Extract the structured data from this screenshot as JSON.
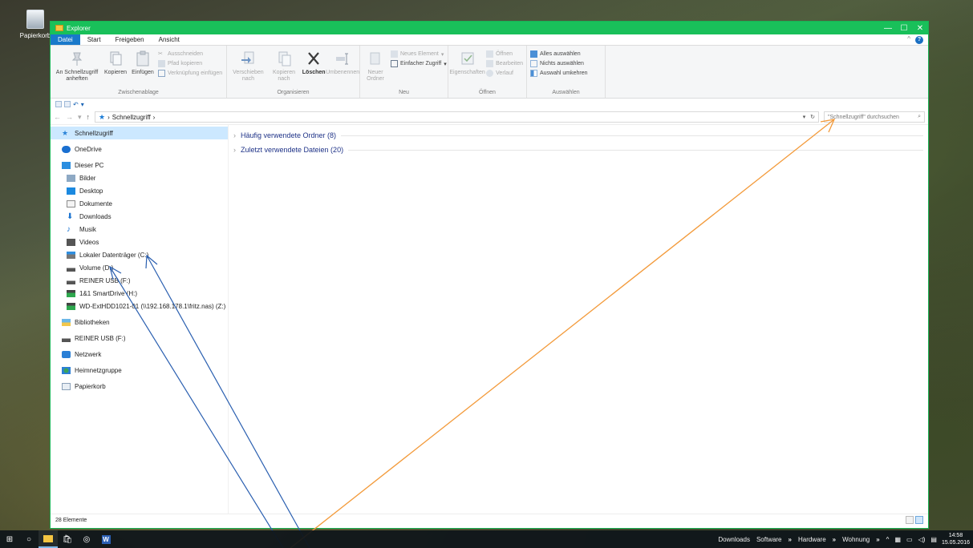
{
  "desktop": {
    "recycle_bin_label": "Papierkorb"
  },
  "window": {
    "title": "Explorer"
  },
  "ribbon_tabs": [
    "Datei",
    "Start",
    "Freigeben",
    "Ansicht"
  ],
  "ribbon": {
    "clipboard": {
      "pin_label": "An Schnellzugriff anheften",
      "copy_label": "Kopieren",
      "paste_label": "Einfügen",
      "cut_label": "Ausschneiden",
      "copy_path_label": "Pfad kopieren",
      "paste_shortcut_label": "Verknüpfung einfügen",
      "group_label": "Zwischenablage"
    },
    "organize": {
      "move_label": "Verschieben nach",
      "copy_to_label": "Kopieren nach",
      "delete_label": "Löschen",
      "rename_label": "Umbenennen",
      "group_label": "Organisieren"
    },
    "new": {
      "new_folder_label": "Neuer Ordner",
      "new_item_label": "Neues Element",
      "easy_access_label": "Einfacher Zugriff",
      "group_label": "Neu"
    },
    "open": {
      "properties_label": "Eigenschaften",
      "open_label": "Öffnen",
      "edit_label": "Bearbeiten",
      "history_label": "Verlauf",
      "group_label": "Öffnen"
    },
    "select": {
      "select_all_label": "Alles auswählen",
      "select_none_label": "Nichts auswählen",
      "invert_label": "Auswahl umkehren",
      "group_label": "Auswählen"
    }
  },
  "address": {
    "crumb": "Schnellzugriff",
    "search_placeholder": "\"Schnellzugriff\" durchsuchen"
  },
  "nav": {
    "quick_access": "Schnellzugriff",
    "onedrive": "OneDrive",
    "this_pc": "Dieser PC",
    "pc_items": [
      "Bilder",
      "Desktop",
      "Dokumente",
      "Downloads",
      "Musik",
      "Videos",
      "Lokaler Datenträger (C:)",
      "Volume (D:)",
      "REINER USB (F:)",
      "1&1 SmartDrive (H:)",
      "WD-ExtHDD1021-01 (\\\\192.168.178.1\\fritz.nas) (Z:)"
    ],
    "libraries": "Bibliotheken",
    "usb": "REINER USB (F:)",
    "network": "Netzwerk",
    "homegroup": "Heimnetzgruppe",
    "recycle": "Papierkorb"
  },
  "content": {
    "frequent_folders": "Häufig verwendete Ordner (8)",
    "recent_files": "Zuletzt verwendete Dateien (20)"
  },
  "status": {
    "count": "28 Elemente"
  },
  "taskbar": {
    "toolbars": [
      "Downloads",
      "Software",
      "Hardware",
      "Wohnung"
    ],
    "chevron": "»",
    "time": "14:58",
    "date": "15.05.2016"
  },
  "colors": {
    "titlebar": "#19c05a",
    "file_tab": "#1979ca",
    "arrow_blue": "#2a5fb0",
    "arrow_orange": "#f39a3a"
  }
}
